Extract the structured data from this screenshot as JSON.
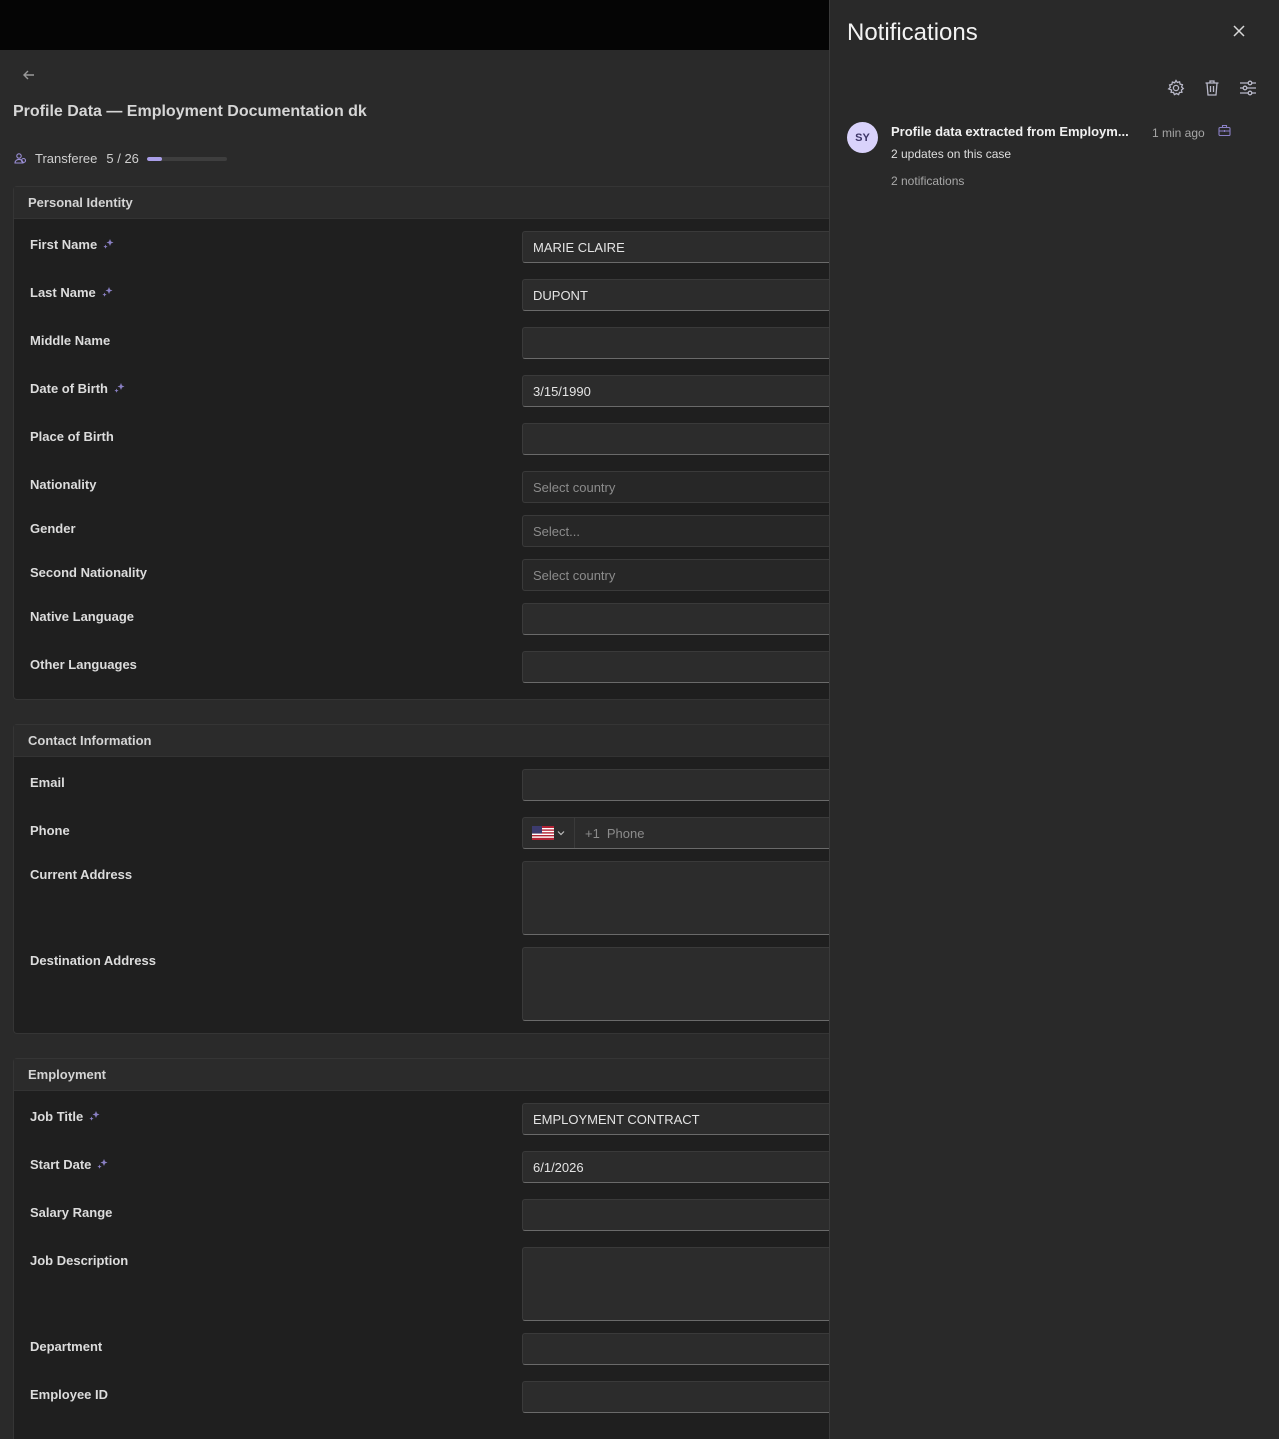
{
  "page": {
    "title": "Profile Data — Employment Documentation dk",
    "progress": {
      "label": "Transferee",
      "count": "5 / 26",
      "fraction": 0.19
    }
  },
  "sections": {
    "personal": {
      "title": "Personal Identity",
      "first_name": {
        "label": "First Name",
        "value": "MARIE CLAIRE"
      },
      "last_name": {
        "label": "Last Name",
        "value": "DUPONT"
      },
      "middle_name": {
        "label": "Middle Name",
        "value": ""
      },
      "dob": {
        "label": "Date of Birth",
        "value": "3/15/1990"
      },
      "pob": {
        "label": "Place of Birth",
        "value": ""
      },
      "nationality": {
        "label": "Nationality",
        "placeholder": "Select country"
      },
      "gender": {
        "label": "Gender",
        "placeholder": "Select..."
      },
      "second_nationality": {
        "label": "Second Nationality",
        "placeholder": "Select country"
      },
      "native_language": {
        "label": "Native Language",
        "value": ""
      },
      "other_languages": {
        "label": "Other Languages",
        "value": ""
      }
    },
    "contact": {
      "title": "Contact Information",
      "email": {
        "label": "Email",
        "value": ""
      },
      "phone": {
        "label": "Phone",
        "prefix": "+1",
        "placeholder": "Phone"
      },
      "current_address": {
        "label": "Current Address",
        "value": ""
      },
      "destination_address": {
        "label": "Destination Address",
        "value": ""
      }
    },
    "employment": {
      "title": "Employment",
      "job_title": {
        "label": "Job Title",
        "value": "EMPLOYMENT CONTRACT"
      },
      "start_date": {
        "label": "Start Date",
        "value": "6/1/2026"
      },
      "salary_range": {
        "label": "Salary Range",
        "value": ""
      },
      "job_description": {
        "label": "Job Description",
        "value": ""
      },
      "department": {
        "label": "Department",
        "value": ""
      },
      "employee_id": {
        "label": "Employee ID",
        "value": ""
      }
    }
  },
  "notifications": {
    "title": "Notifications",
    "items": [
      {
        "avatar": "SY",
        "title": "Profile data extracted from Employm...",
        "time": "1 min ago",
        "subtitle": "2 updates on this case",
        "count": "2 notifications"
      }
    ]
  },
  "colors": {
    "accent": "#a99ee8",
    "avatar_bg": "#d9d2fb",
    "panel_bg": "#292929"
  },
  "icons": [
    "back-arrow-icon",
    "transferee-icon",
    "ai-sparkle-icon",
    "us-flag-icon",
    "chevron-down-icon",
    "close-icon",
    "settings-gear-icon",
    "trash-icon",
    "filter-sliders-icon",
    "case-briefcase-icon"
  ]
}
